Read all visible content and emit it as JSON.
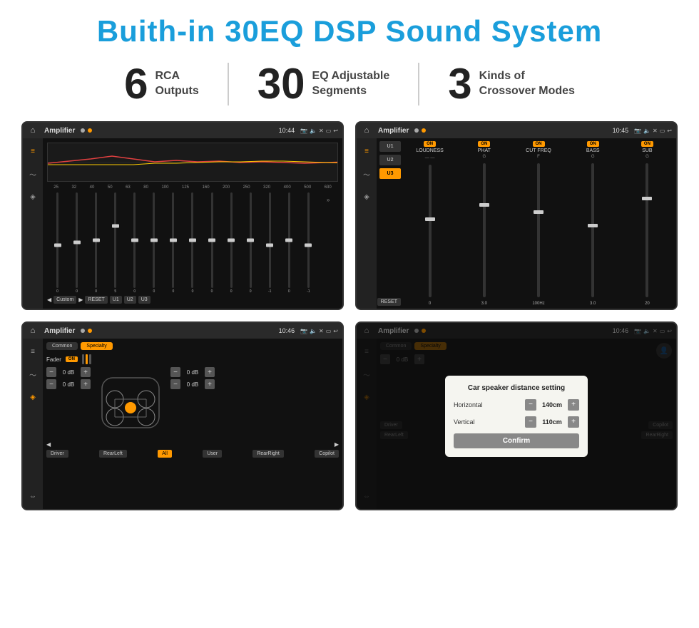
{
  "page": {
    "title": "Buith-in 30EQ DSP Sound System",
    "stats": [
      {
        "number": "6",
        "label": "RCA\nOutputs"
      },
      {
        "number": "30",
        "label": "EQ Adjustable\nSegments"
      },
      {
        "number": "3",
        "label": "Kinds of\nCrossover Modes"
      }
    ],
    "screens": [
      {
        "id": "eq-screen",
        "statusBar": {
          "title": "Amplifier",
          "time": "10:44"
        },
        "type": "eq"
      },
      {
        "id": "crossover-screen",
        "statusBar": {
          "title": "Amplifier",
          "time": "10:45"
        },
        "type": "crossover"
      },
      {
        "id": "fader-screen",
        "statusBar": {
          "title": "Amplifier",
          "time": "10:46"
        },
        "type": "fader"
      },
      {
        "id": "dialog-screen",
        "statusBar": {
          "title": "Amplifier",
          "time": "10:46"
        },
        "type": "dialog"
      }
    ],
    "eq": {
      "freqLabels": [
        "25",
        "32",
        "40",
        "50",
        "63",
        "80",
        "100",
        "125",
        "160",
        "200",
        "250",
        "320",
        "400",
        "500",
        "630"
      ],
      "values": [
        "0",
        "0",
        "0",
        "5",
        "0",
        "0",
        "0",
        "0",
        "0",
        "0",
        "0",
        "-1",
        "0",
        "-1"
      ],
      "mode": "Custom",
      "buttons": [
        "RESET",
        "U1",
        "U2",
        "U3"
      ]
    },
    "crossover": {
      "presets": [
        "U1",
        "U2",
        "U3"
      ],
      "activePreset": "U3",
      "toggles": [
        "LOUDNESS",
        "PHAT",
        "CUT FREQ",
        "BASS",
        "SUB"
      ],
      "resetLabel": "RESET"
    },
    "fader": {
      "tabs": [
        "Common",
        "Specialty"
      ],
      "activeTab": "Specialty",
      "faderLabel": "Fader",
      "onLabel": "ON",
      "gains": [
        "0 dB",
        "0 dB",
        "0 dB",
        "0 dB"
      ],
      "footerBtns": [
        "Driver",
        "RearLeft",
        "All",
        "User",
        "RearRight",
        "Copilot"
      ]
    },
    "dialog": {
      "title": "Car speaker distance setting",
      "fields": [
        {
          "label": "Horizontal",
          "value": "140cm"
        },
        {
          "label": "Vertical",
          "value": "110cm"
        }
      ],
      "confirmLabel": "Confirm",
      "faderTabs": [
        "Common",
        "Specialty"
      ],
      "faderGains": [
        "0 dB",
        "0 dB"
      ]
    }
  }
}
